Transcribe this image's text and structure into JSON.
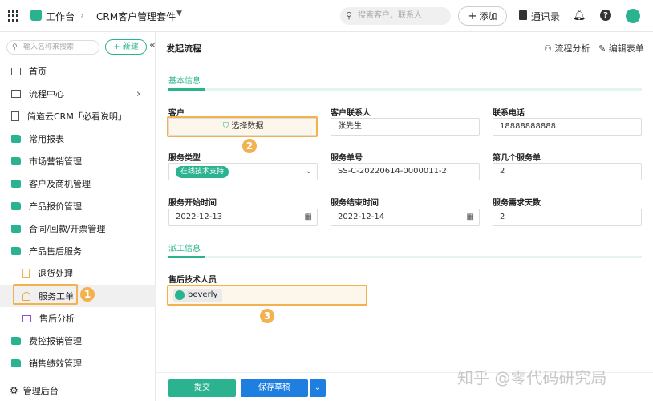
{
  "topbar": {
    "workspace": "工作台",
    "app_title": "CRM客户管理套件",
    "search_placeholder": "搜索客户、联系人",
    "add_label": "添加",
    "contacts_label": "通讯录"
  },
  "sidebar": {
    "search_placeholder": "输入名称来搜索",
    "new_label": "新建",
    "items": [
      {
        "label": "首页"
      },
      {
        "label": "流程中心"
      },
      {
        "label": "简道云CRM「必看说明」"
      },
      {
        "label": "常用报表"
      },
      {
        "label": "市场营销管理"
      },
      {
        "label": "客户及商机管理"
      },
      {
        "label": "产品报价管理"
      },
      {
        "label": "合同/回款/开票管理"
      },
      {
        "label": "产品售后服务"
      },
      {
        "label": "退货处理"
      },
      {
        "label": "服务工单"
      },
      {
        "label": "售后分析"
      },
      {
        "label": "费控报销管理"
      },
      {
        "label": "销售绩效管理"
      }
    ],
    "admin_label": "管理后台"
  },
  "main": {
    "title": "发起流程",
    "flow_analysis": "流程分析",
    "edit_form": "编辑表单",
    "section_basic": "基本信息",
    "section_dispatch": "派工信息",
    "fields": {
      "customer_label": "客户",
      "customer_button": "选择数据",
      "contact_label": "客户联系人",
      "contact_value": "张先生",
      "phone_label": "联系电话",
      "phone_value": "18888888888",
      "service_type_label": "服务类型",
      "service_type_value": "在线技术支持",
      "order_no_label": "服务单号",
      "order_no_value": "SS-C-20220614-0000011-2",
      "nth_label": "第几个服务单",
      "nth_value": "2",
      "start_label": "服务开始时间",
      "start_value": "2022-12-13",
      "end_label": "服务结束时间",
      "end_value": "2022-12-14",
      "days_label": "服务需求天数",
      "days_value": "2",
      "tech_label": "售后技术人员",
      "tech_value": "beverly"
    },
    "submit_label": "提交",
    "draft_label": "保存草稿"
  },
  "annotations": [
    "1",
    "2",
    "3"
  ],
  "watermark": "知乎 @零代码研究局",
  "colors": {
    "accent": "#2bb38f",
    "highlight": "#f3b24f"
  }
}
